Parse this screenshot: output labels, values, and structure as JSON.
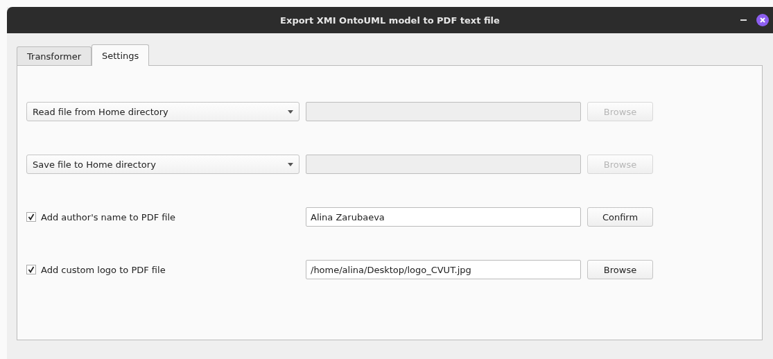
{
  "window": {
    "title": "Export XMI OntoUML model to PDF text file"
  },
  "tabs": [
    {
      "label": "Transformer",
      "selected": false
    },
    {
      "label": "Settings",
      "selected": true
    }
  ],
  "rows": [
    {
      "kind": "dropdown",
      "label": "Read file from Home directory",
      "field": {
        "disabled": true
      },
      "button": {
        "label": "Browse",
        "disabled": true
      }
    },
    {
      "kind": "dropdown",
      "label": "Save file to Home directory",
      "field": {
        "disabled": true
      },
      "button": {
        "label": "Browse",
        "disabled": true
      }
    },
    {
      "kind": "checkbox",
      "label": "Add author's name to PDF file",
      "checked": true,
      "field": {
        "value": "Alina Zarubaeva",
        "disabled": false
      },
      "button": {
        "label": "Confirm",
        "disabled": false
      }
    },
    {
      "kind": "checkbox",
      "label": "Add custom logo to PDF file",
      "checked": true,
      "field": {
        "value": "/home/alina/Desktop/logo_CVUT.jpg",
        "disabled": false
      },
      "button": {
        "label": "Browse",
        "disabled": false
      }
    }
  ]
}
